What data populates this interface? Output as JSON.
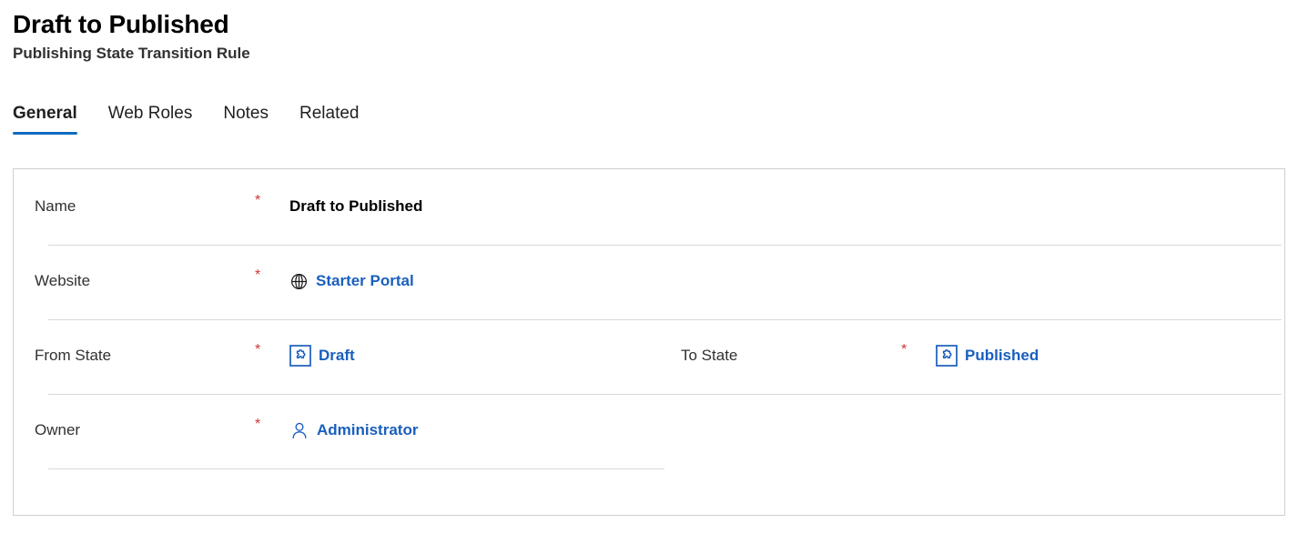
{
  "header": {
    "title": "Draft to Published",
    "subtitle": "Publishing State Transition Rule"
  },
  "tabs": [
    {
      "label": "General",
      "active": true
    },
    {
      "label": "Web Roles",
      "active": false
    },
    {
      "label": "Notes",
      "active": false
    },
    {
      "label": "Related",
      "active": false
    }
  ],
  "form": {
    "required_marker": "*",
    "fields": {
      "name": {
        "label": "Name",
        "value": "Draft to Published",
        "type": "text",
        "required": true
      },
      "website": {
        "label": "Website",
        "value": "Starter Portal",
        "type": "lookup",
        "icon": "globe-icon",
        "required": true
      },
      "from_state": {
        "label": "From State",
        "value": "Draft",
        "type": "lookup",
        "icon": "puzzle-piece-icon",
        "required": true
      },
      "to_state": {
        "label": "To State",
        "value": "Published",
        "type": "lookup",
        "icon": "puzzle-piece-icon",
        "required": true
      },
      "owner": {
        "label": "Owner",
        "value": "Administrator",
        "type": "lookup",
        "icon": "person-icon",
        "required": true
      }
    }
  },
  "colors": {
    "link": "#1a5fbd",
    "accent": "#0f6cbd",
    "required": "#d13438",
    "text": "#201f1e",
    "border": "#d2d0ce",
    "divider": "#d9d9d9"
  }
}
